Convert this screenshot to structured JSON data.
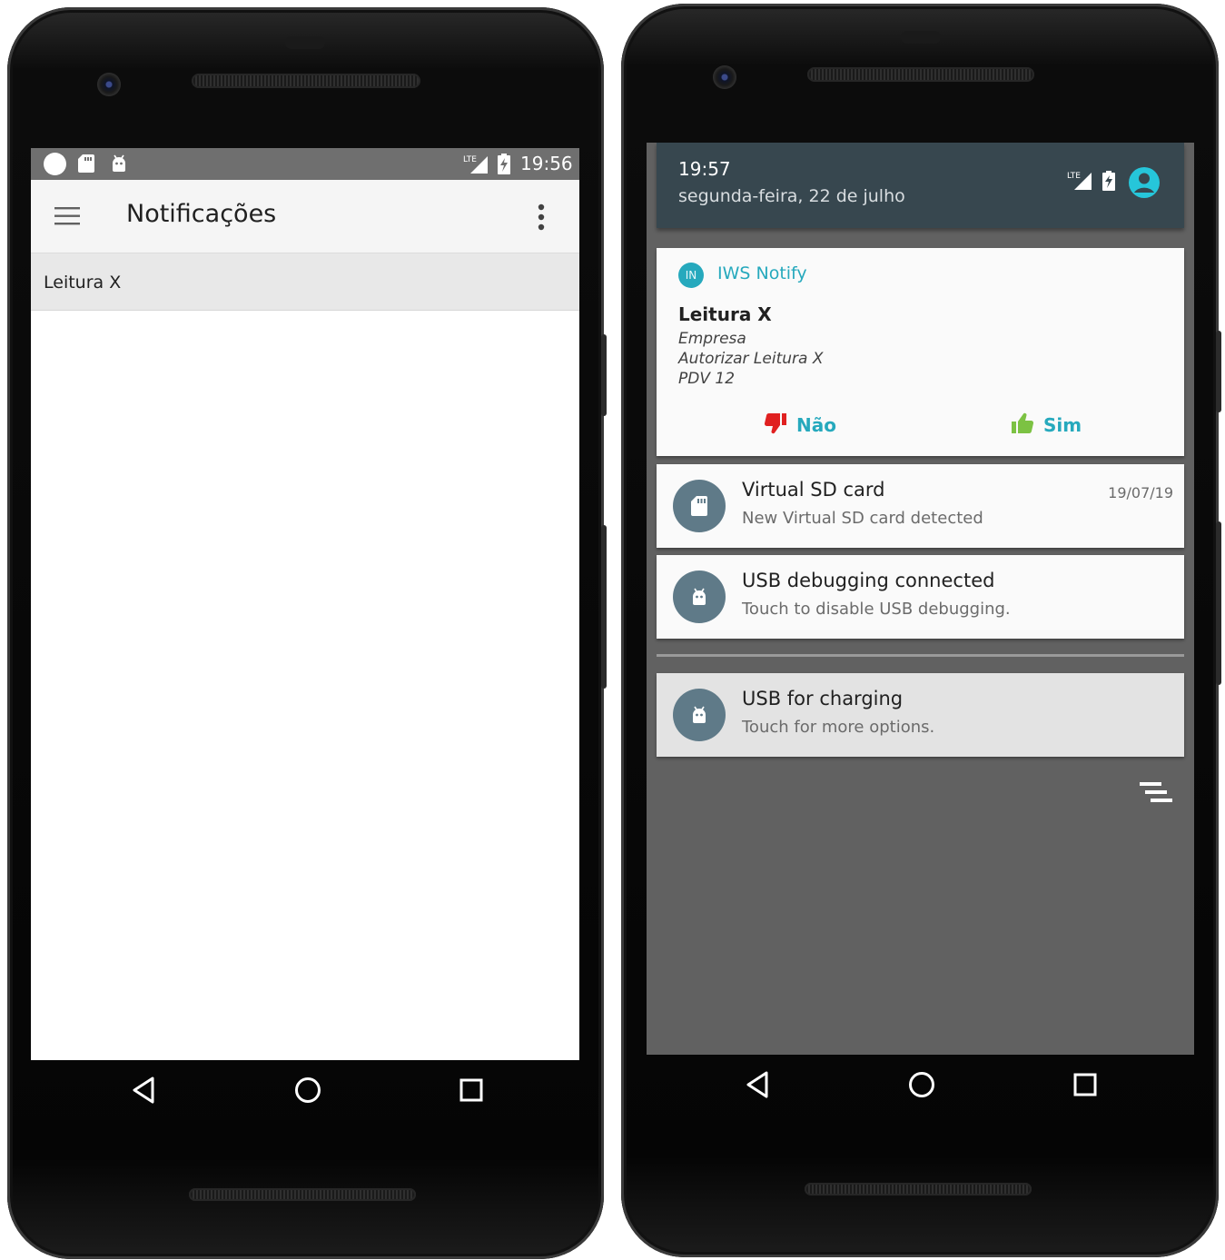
{
  "left_phone": {
    "status_time": "19:56",
    "status_network": "LTE",
    "app_title": "Notificações",
    "list_items": [
      {
        "label": "Leitura X"
      }
    ]
  },
  "right_phone": {
    "time": "19:57",
    "date": "segunda-feira, 22 de julho",
    "status_network": "LTE",
    "notifications": {
      "iws": {
        "app_icon_text": "IN",
        "app_name": "IWS Notify",
        "title": "Leitura X",
        "lines": [
          "Empresa",
          "Autorizar Leitura X",
          "PDV 12"
        ],
        "action_no": "Não",
        "action_yes": "Sim"
      },
      "sd": {
        "title": "Virtual SD card",
        "text": "New Virtual SD card detected",
        "date": "19/07/19"
      },
      "usb_debug": {
        "title": "USB debugging connected",
        "text": "Touch to disable USB debugging."
      },
      "usb_charge": {
        "title": "USB for charging",
        "text": "Touch for more options."
      }
    }
  },
  "colors": {
    "accent": "#26a9bd",
    "no_red": "#e02020",
    "yes_green": "#7cc243",
    "shade_header": "#37474f",
    "shade_bg": "#616161",
    "notif_icon": "#5f7a88"
  },
  "icons": [
    "menu-icon",
    "more-vert-icon",
    "back-icon",
    "home-icon",
    "recents-icon",
    "thumbs-down-icon",
    "thumbs-up-icon",
    "sd-card-icon",
    "android-icon",
    "signal-icon",
    "battery-icon",
    "account-icon",
    "clear-all-icon"
  ]
}
